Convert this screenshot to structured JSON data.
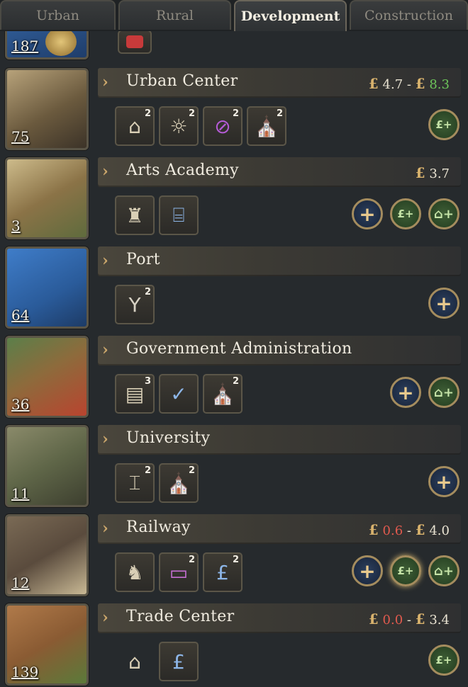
{
  "tabs": [
    {
      "label": "Urban"
    },
    {
      "label": "Rural"
    },
    {
      "label": "Development"
    },
    {
      "label": "Construction"
    }
  ],
  "top_partial": {
    "count": "187"
  },
  "buildings": [
    {
      "name": "Urban Center",
      "count": "75",
      "money": {
        "from": "4.7",
        "to": "8.3",
        "from_color": "neutral",
        "to_color": "green"
      },
      "icons": [
        {
          "icon": "market-stall-icon",
          "badge": "2"
        },
        {
          "icon": "street-lamp-icon",
          "badge": "2"
        },
        {
          "icon": "no-tram-icon",
          "badge": "2"
        },
        {
          "icon": "prayer-hands-icon",
          "badge": "2"
        }
      ],
      "actions": [
        "money"
      ]
    },
    {
      "name": "Arts Academy",
      "count": "3",
      "money": {
        "single": "3.7"
      },
      "icons": [
        {
          "icon": "statue-painting-icon",
          "badge": ""
        },
        {
          "icon": "institution-chair-icon",
          "badge": ""
        }
      ],
      "actions": [
        "plus",
        "money",
        "house"
      ]
    },
    {
      "name": "Port",
      "count": "64",
      "money": null,
      "icons": [
        {
          "icon": "fork-icon",
          "badge": "2"
        }
      ],
      "actions": [
        "plus"
      ]
    },
    {
      "name": "Government Administration",
      "count": "36",
      "money": null,
      "icons": [
        {
          "icon": "filing-cabinet-icon",
          "badge": "3"
        },
        {
          "icon": "bureaucrat-check-icon",
          "badge": ""
        },
        {
          "icon": "prayer-hands-icon",
          "badge": "2"
        }
      ],
      "actions": [
        "plus",
        "house"
      ]
    },
    {
      "name": "University",
      "count": "11",
      "money": null,
      "icons": [
        {
          "icon": "classical-building-icon",
          "badge": "2"
        },
        {
          "icon": "prayer-hands-icon",
          "badge": "2"
        }
      ],
      "actions": [
        "plus"
      ]
    },
    {
      "name": "Railway",
      "count": "12",
      "money": {
        "from": "0.6",
        "to": "4.0",
        "from_color": "red",
        "to_color": "neutral"
      },
      "icons": [
        {
          "icon": "locomotive-icon",
          "badge": ""
        },
        {
          "icon": "rail-car-icon",
          "badge": "2"
        },
        {
          "icon": "hand-pound-icon",
          "badge": "2"
        }
      ],
      "actions": [
        "plus",
        "money",
        "house"
      ]
    },
    {
      "name": "Trade Center",
      "count": "139",
      "money": {
        "from": "0.0",
        "to": "3.4",
        "from_color": "red",
        "to_color": "neutral"
      },
      "icons": [
        {
          "icon": "guildhall-icon",
          "badge": ""
        },
        {
          "icon": "hand-pound-icon",
          "badge": ""
        }
      ],
      "actions": [
        "money"
      ]
    }
  ],
  "symbols": {
    "pound": "£",
    "dash": "-",
    "plus": "+",
    "money_btn": "£+",
    "house_btn": "⌂+"
  },
  "colors": {
    "gold": "#d8b26d",
    "green": "#6cc45a",
    "red": "#e05a4e",
    "tab_active": "#f3eee2"
  }
}
